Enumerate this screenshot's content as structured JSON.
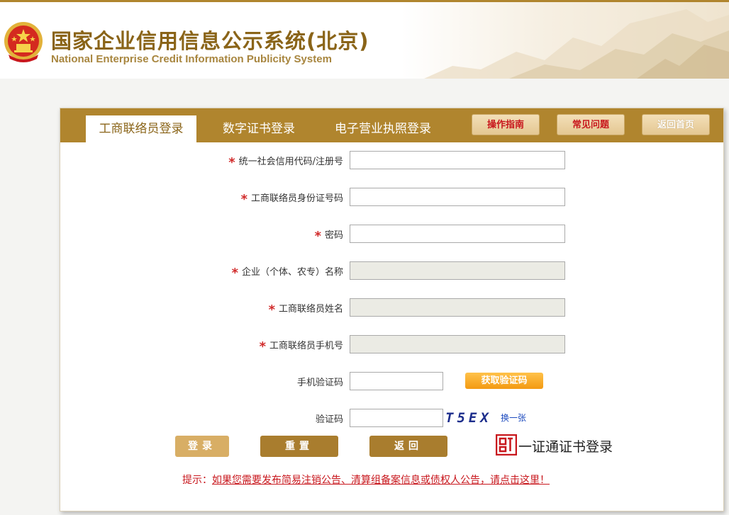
{
  "header": {
    "title_cn": "国家企业信用信息公示系统(北京)",
    "title_en": "National Enterprise Credit Information Publicity System"
  },
  "tabs": [
    {
      "label": "工商联络员登录",
      "active": true
    },
    {
      "label": "数字证书登录",
      "active": false
    },
    {
      "label": "电子营业执照登录",
      "active": false
    }
  ],
  "top_buttons": {
    "guide": "操作指南",
    "faq": "常见问题",
    "home": "返回首页"
  },
  "form": {
    "credit_code": {
      "label": "统一社会信用代码/注册号",
      "value": ""
    },
    "id_number": {
      "label": "工商联络员身份证号码",
      "value": ""
    },
    "password": {
      "label": "密码",
      "value": ""
    },
    "company_name": {
      "label": "企业（个体、农专）名称",
      "value": ""
    },
    "contact_name": {
      "label": "工商联络员姓名",
      "value": ""
    },
    "contact_phone": {
      "label": "工商联络员手机号",
      "value": ""
    },
    "sms_code": {
      "label": "手机验证码",
      "value": ""
    },
    "captcha": {
      "label": "验证码",
      "value": "",
      "image_text": "T5EX",
      "refresh": "换一张"
    },
    "required_mark": "*",
    "get_sms_button": "获取验证码"
  },
  "actions": {
    "login": "登录",
    "reset": "重置",
    "back": "返回",
    "cert_login": "一证通证书登录"
  },
  "notice": {
    "prefix": "提示：",
    "link_text": "如果您需要发布简易注销公告、清算组备案信息或债权人公告，请点击这里！"
  },
  "colors": {
    "brand_gold": "#b0852e",
    "title_brown": "#8a6418",
    "required_red": "#d12a2a",
    "notice_red": "#c8171d",
    "sms_orange": "#f39a12"
  }
}
